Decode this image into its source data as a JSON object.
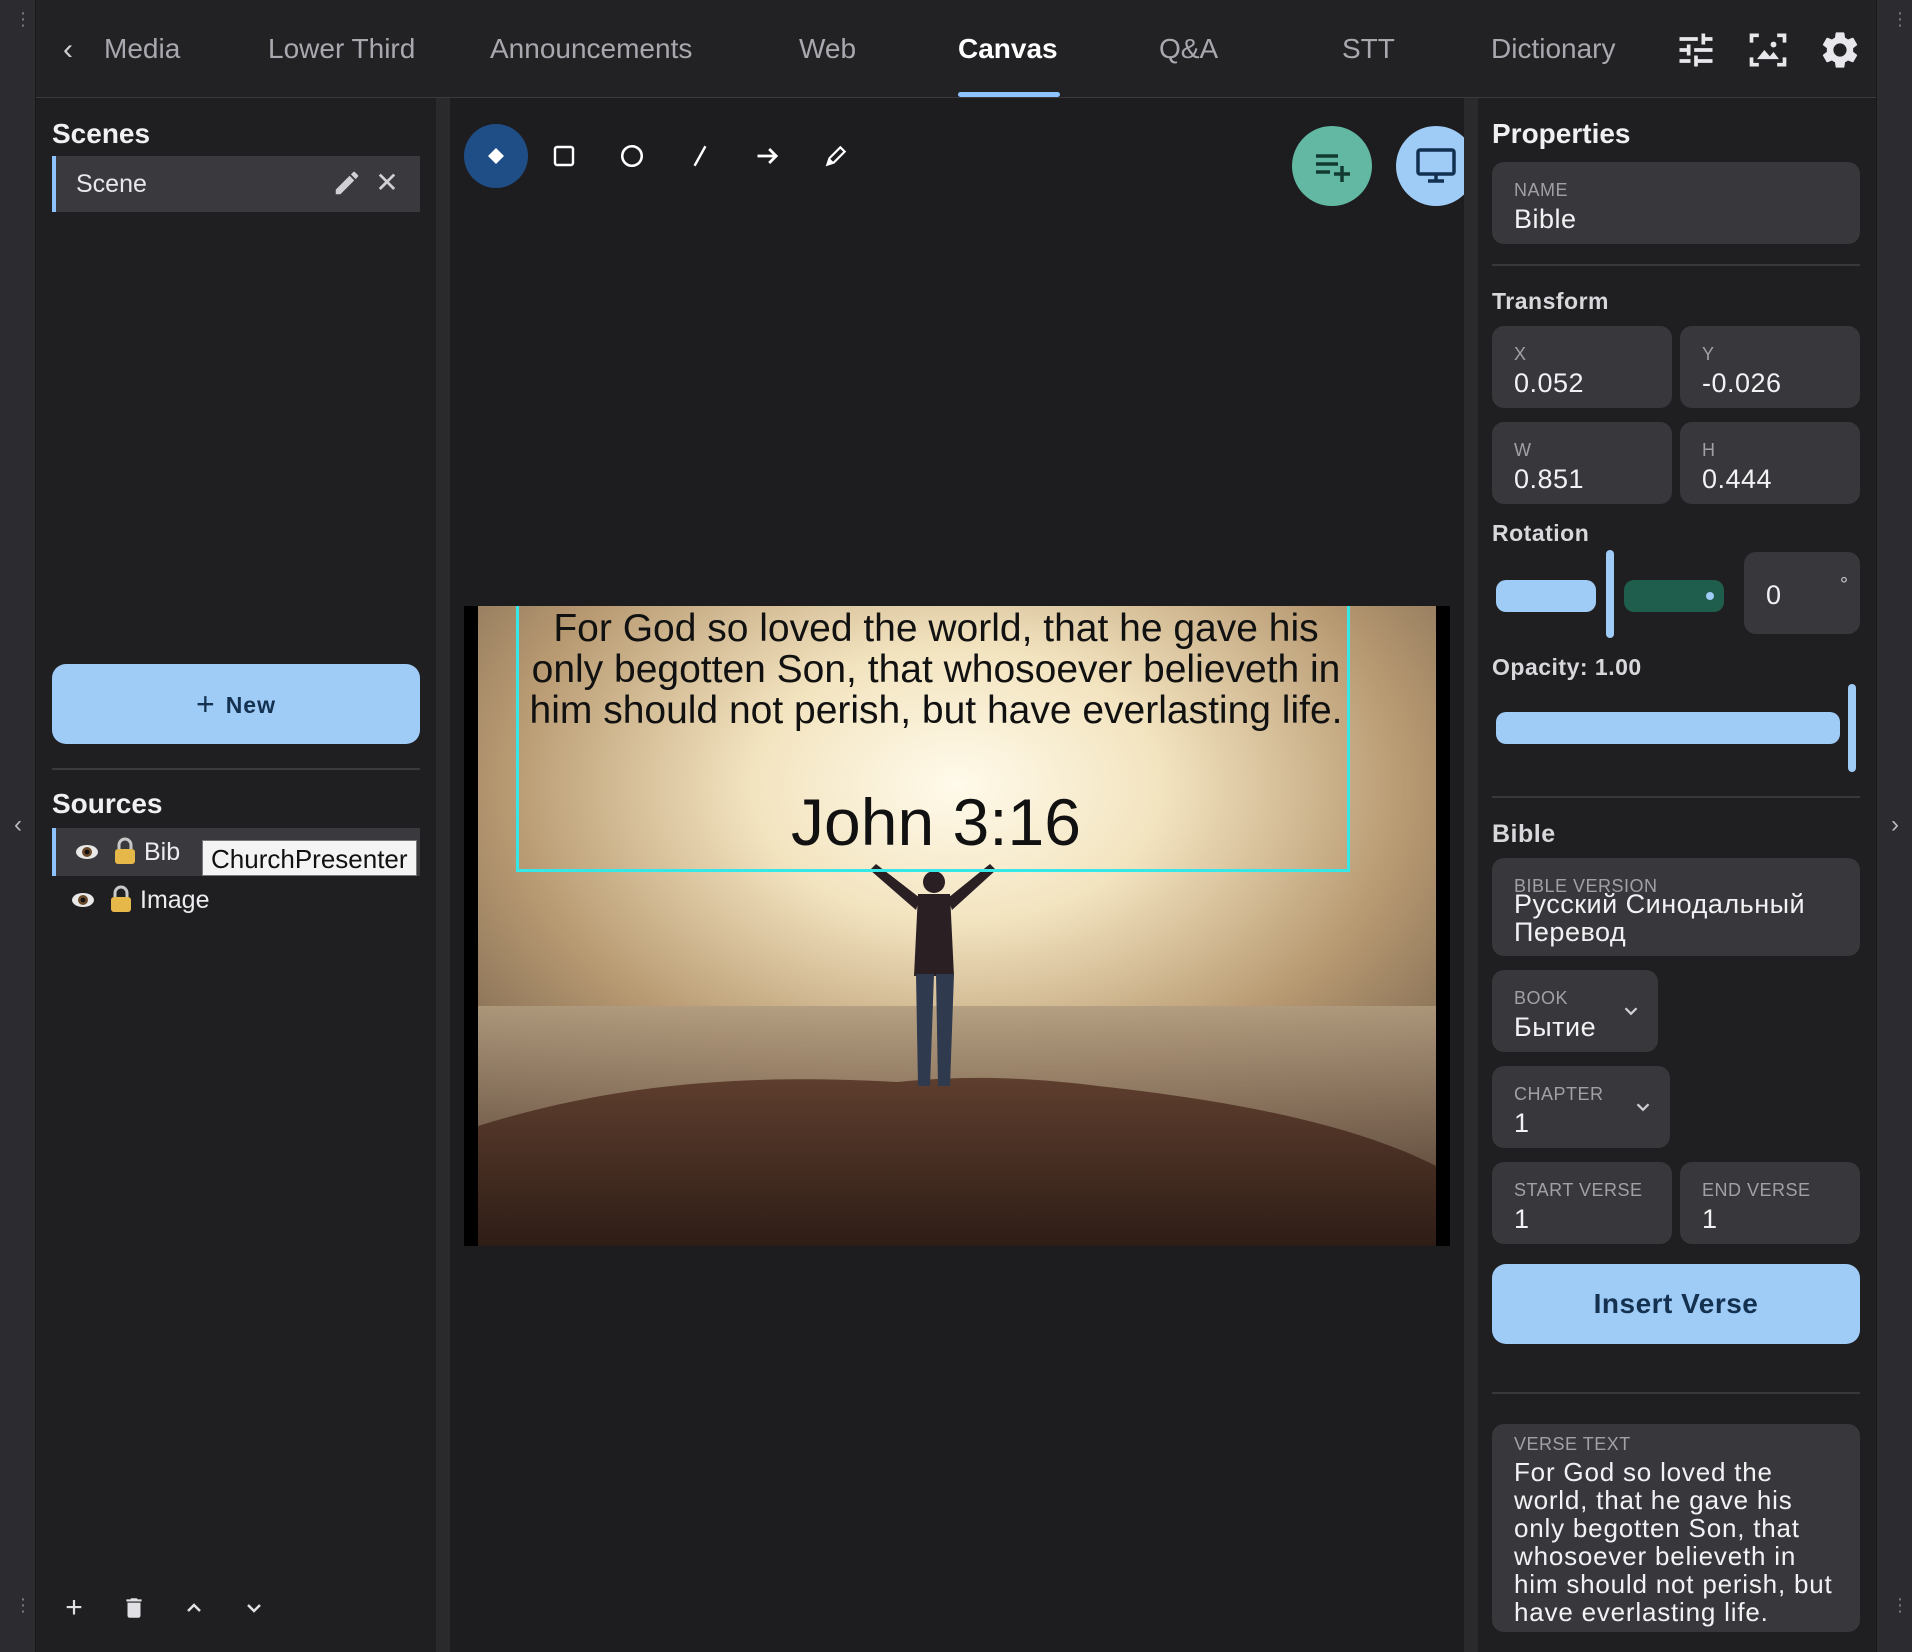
{
  "tabs": [
    {
      "label": "Media",
      "active": false
    },
    {
      "label": "Lower Third",
      "active": false
    },
    {
      "label": "Announcements",
      "active": false
    },
    {
      "label": "Web",
      "active": false
    },
    {
      "label": "Canvas",
      "active": true
    },
    {
      "label": "Q&A",
      "active": false
    },
    {
      "label": "STT",
      "active": false
    },
    {
      "label": "Dictionary",
      "active": false
    }
  ],
  "top_icons": [
    "sliders-icon",
    "image-frame-icon",
    "gear-icon"
  ],
  "scenes": {
    "title": "Scenes",
    "items": [
      {
        "label": "Scene",
        "selected": true
      }
    ],
    "new_button": "New"
  },
  "sources": {
    "title": "Sources",
    "items": [
      {
        "label": "Bib",
        "selected": true
      },
      {
        "label": "Image",
        "selected": false
      }
    ],
    "tooltip": "ChurchPresenter"
  },
  "toolbar": {
    "tools": [
      "select-diamond-icon",
      "rectangle-icon",
      "circle-icon",
      "line-icon",
      "arrow-icon",
      "pencil-icon"
    ],
    "active_tool": "select-diamond-icon",
    "actions": [
      "add-to-playlist-icon",
      "monitor-icon"
    ]
  },
  "canvas": {
    "verse_text": "For God so loved the world, that he gave his only begotten Son, that whosoever believeth in him should not perish, but have everlasting life.",
    "verse_reference": "John 3:16",
    "colors": {
      "selection": "#35e7e7"
    }
  },
  "properties": {
    "title": "Properties",
    "name": {
      "label": "NAME",
      "value": "Bible"
    },
    "transform": {
      "title": "Transform",
      "x": {
        "label": "X",
        "value": "0.052"
      },
      "y": {
        "label": "Y",
        "value": "-0.026"
      },
      "w": {
        "label": "W",
        "value": "0.851"
      },
      "h": {
        "label": "H",
        "value": "0.444"
      }
    },
    "rotation": {
      "label": "Rotation",
      "value": "0",
      "unit": "°",
      "slider_fraction": 0.5
    },
    "opacity": {
      "label": "Opacity: 1.00",
      "value": 1.0
    }
  },
  "bible": {
    "title": "Bible",
    "version": {
      "label": "BIBLE VERSION",
      "value": "Русский Синодальный Перевод"
    },
    "book": {
      "label": "BOOK",
      "value": "Бытие"
    },
    "chapter": {
      "label": "CHAPTER",
      "value": "1"
    },
    "start_verse": {
      "label": "START VERSE",
      "value": "1"
    },
    "end_verse": {
      "label": "END VERSE",
      "value": "1"
    },
    "insert_button": "Insert Verse",
    "verse_text": {
      "label": "VERSE TEXT",
      "value": "For God so loved the world, that he gave his only begotten Son, that whosoever believeth in him should not perish, but have everlasting life."
    }
  },
  "colors": {
    "accent": "#9fcbf7",
    "accent_dark": "#1f4d86",
    "green_fab": "#62b8a3",
    "panel": "#38383c"
  }
}
